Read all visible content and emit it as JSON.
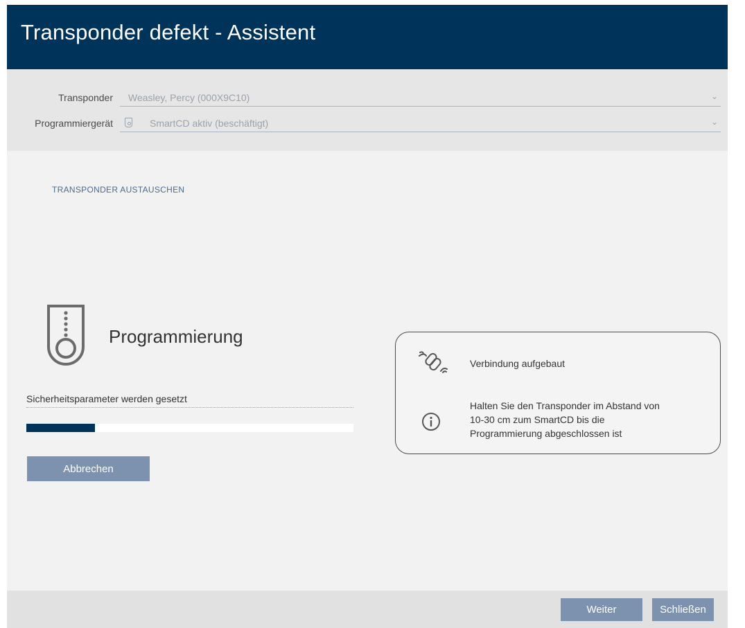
{
  "window": {
    "title": "Transponder defekt - Assistent"
  },
  "form": {
    "transponder": {
      "label": "Transponder",
      "value": "Weasley, Percy (000X9C10)"
    },
    "device": {
      "label": "Programmiergerät",
      "value": "SmartCD aktiv (beschäftigt)",
      "icon": "device-icon"
    }
  },
  "section": {
    "title": "TRANSPONDER AUSTAUSCHEN"
  },
  "programming": {
    "title": "Programmierung",
    "status": "Sicherheitsparameter werden gesetzt",
    "progress": 0.21,
    "cancel_label": "Abbrechen"
  },
  "info": {
    "connection": "Verbindung aufgebaut",
    "hint_lines": [
      "Halten Sie den Transponder im Abstand von",
      "10-30 cm zum SmartCD bis die",
      "Programmierung abgeschlossen ist"
    ]
  },
  "footer": {
    "next_label": "Weiter",
    "close_label": "Schließen"
  },
  "colors": {
    "accent": "#003359",
    "button": "#7d92ae"
  }
}
